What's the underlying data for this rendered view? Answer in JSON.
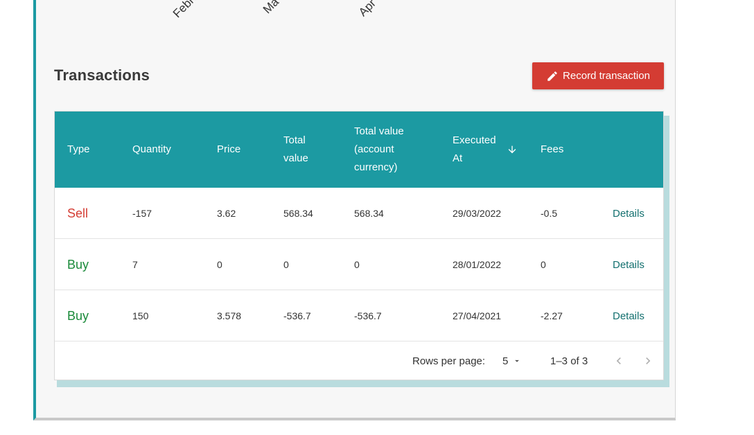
{
  "chart_axis": {
    "labels": [
      "Febru",
      "Ma",
      "Apr"
    ]
  },
  "transactions": {
    "title": "Transactions",
    "record_button_label": "Record transaction",
    "columns": {
      "type": "Type",
      "quantity": "Quantity",
      "price": "Price",
      "total_value": "Total value",
      "total_value_account": "Total value (account currency)",
      "executed_at": "Executed At",
      "fees": "Fees"
    },
    "rows": [
      {
        "type": "Sell",
        "quantity": "-157",
        "price": "3.62",
        "total_value": "568.34",
        "total_value_account": "568.34",
        "executed_at": "29/03/2022",
        "fees": "-0.5",
        "action": "Details"
      },
      {
        "type": "Buy",
        "quantity": "7",
        "price": "0",
        "total_value": "0",
        "total_value_account": "0",
        "executed_at": "28/01/2022",
        "fees": "0",
        "action": "Details"
      },
      {
        "type": "Buy",
        "quantity": "150",
        "price": "3.578",
        "total_value": "-536.7",
        "total_value_account": "-536.7",
        "executed_at": "27/04/2021",
        "fees": "-2.27",
        "action": "Details"
      }
    ],
    "pagination": {
      "rows_per_page_label": "Rows per page:",
      "rows_per_page_value": "5",
      "range_text": "1–3 of 3"
    }
  },
  "colors": {
    "header_teal": "#1c9aa2",
    "sell_red": "#d43c33",
    "buy_green": "#1a8a3a",
    "button_red": "#d43c33"
  },
  "icons": {
    "record": "pencil-icon",
    "sort": "arrow-down-icon",
    "dropdown": "caret-down-icon",
    "prev": "chevron-left-icon",
    "next": "chevron-right-icon"
  }
}
